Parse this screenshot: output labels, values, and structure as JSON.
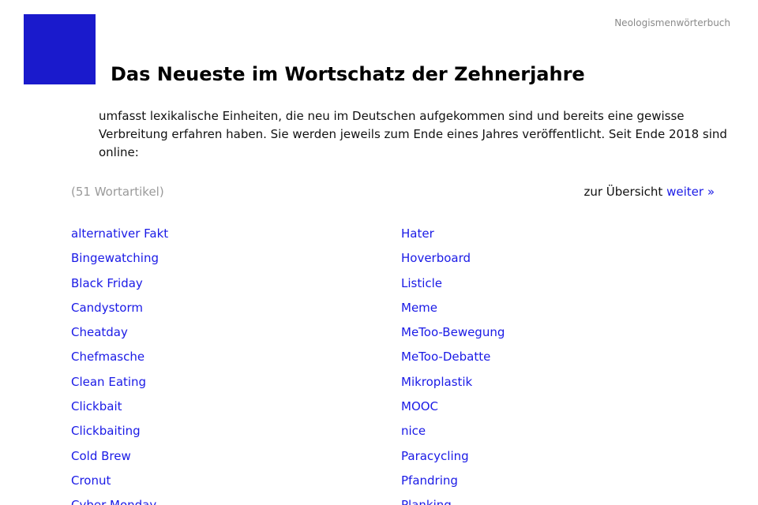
{
  "header": {
    "site_name": "Neologismenwörterbuch",
    "title": "Das Neueste im Wortschatz der Zehnerjahre"
  },
  "intro": {
    "text": "umfasst lexikalische Einheiten, die neu im Deutschen aufgekommen sind und bereits eine gewisse Verbreitung erfahren haben. Sie werden jeweils zum Ende eines Jahres veröffentlicht. Seit Ende 2018 sind online:"
  },
  "meta": {
    "count_label": "(51 Wortartikel)",
    "overview_label": "zur Übersicht",
    "next_label": "weiter »"
  },
  "colors": {
    "brand_block": "#1a1acc",
    "link": "#1a1ae6"
  },
  "words": {
    "left": [
      "alternativer Fakt",
      "Bingewatching",
      "Black Friday",
      "Candystorm",
      "Cheatday",
      "Chefmasche",
      "Clean Eating",
      "Clickbait",
      "Clickbaiting",
      "Cold Brew",
      "Cronut",
      "Cyber Monday"
    ],
    "right": [
      "Hater",
      "Hoverboard",
      "Listicle",
      "Meme",
      "MeToo-Bewegung",
      "MeToo-Debatte",
      "Mikroplastik",
      "MOOC",
      "nice",
      "Paracycling",
      "Pfandring",
      "Planking"
    ]
  }
}
